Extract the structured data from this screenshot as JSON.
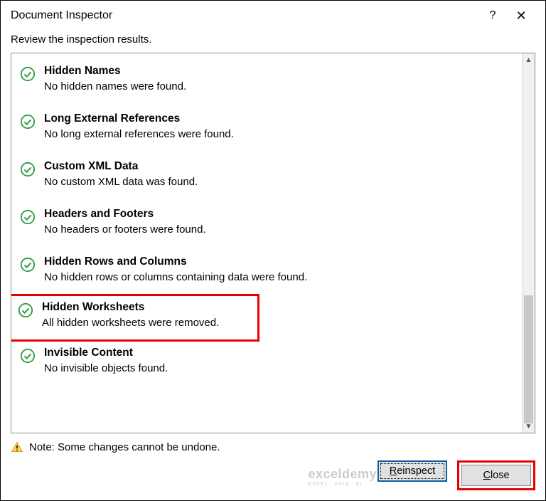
{
  "title": "Document Inspector",
  "subtitle": "Review the inspection results.",
  "items": [
    {
      "heading": "Hidden Names",
      "desc": "No hidden names were found."
    },
    {
      "heading": "Long External References",
      "desc": "No long external references were found."
    },
    {
      "heading": "Custom XML Data",
      "desc": "No custom XML data was found."
    },
    {
      "heading": "Headers and Footers",
      "desc": "No headers or footers were found."
    },
    {
      "heading": "Hidden Rows and Columns",
      "desc": "No hidden rows or columns containing data were found."
    },
    {
      "heading": "Hidden Worksheets",
      "desc": "All hidden worksheets were removed."
    },
    {
      "heading": "Invisible Content",
      "desc": "No invisible objects found."
    }
  ],
  "note": "Note: Some changes cannot be undone.",
  "buttons": {
    "reinspect": "Reinspect",
    "close": "Close"
  },
  "watermark": {
    "name": "exceldemy",
    "tag": "EXCEL · DATA · BI"
  }
}
